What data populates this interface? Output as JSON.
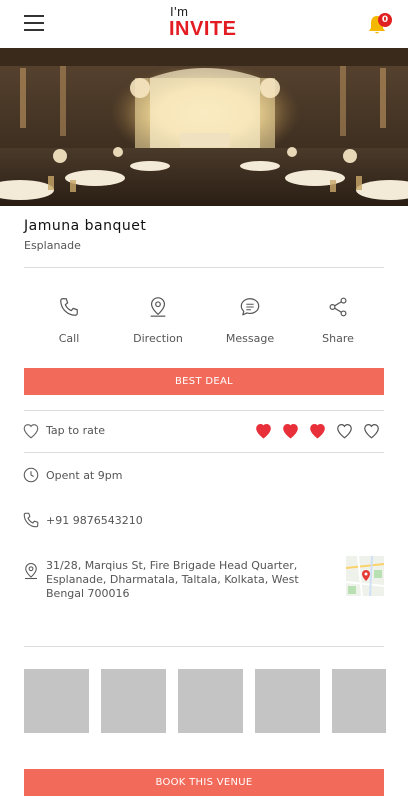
{
  "header": {
    "logo_small": "I'm",
    "logo_main": "INVITE",
    "notification_count": "0"
  },
  "venue": {
    "name": "Jamuna banquet",
    "area": "Esplanade"
  },
  "actions": [
    {
      "label": "Call",
      "icon": "phone-icon"
    },
    {
      "label": "Direction",
      "icon": "location-pin-icon"
    },
    {
      "label": "Message",
      "icon": "message-icon"
    },
    {
      "label": "Share",
      "icon": "share-icon"
    }
  ],
  "best_deal_label": "BEST DEAL",
  "rating": {
    "prompt": "Tap to rate",
    "value": 3,
    "max": 5,
    "filled_color": "#e8303a"
  },
  "info": {
    "hours": "Opent at 9pm",
    "phone": "+91 9876543210",
    "address": "31/28, Marqius St, Fire Brigade Head Quarter, Esplanade, Dharmatala, Taltala, Kolkata, West Bengal 700016"
  },
  "gallery_count": 5,
  "book_label": "BOOK THIS VENUE",
  "colors": {
    "accent": "#f26a5a",
    "brand_red": "#e31b23",
    "bell": "#f5b800"
  }
}
